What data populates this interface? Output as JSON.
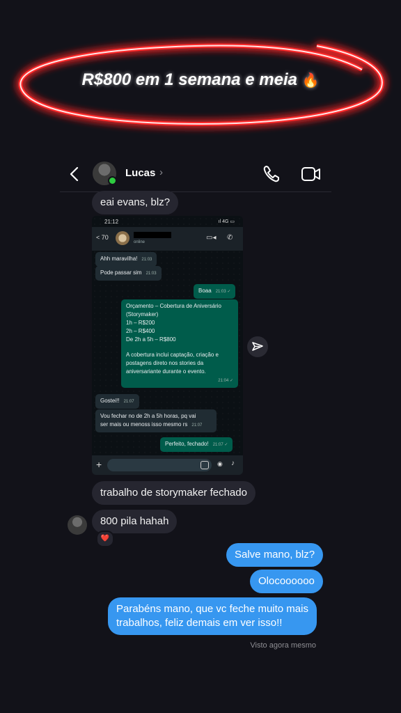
{
  "headline": {
    "text": "R$800 em 1 semana e meia",
    "emoji": "🔥"
  },
  "header": {
    "contact_name": "Lucas",
    "chevron": "›",
    "online": true
  },
  "icons": {
    "back": "chevron-left-icon",
    "call": "phone-icon",
    "video": "video-camera-icon",
    "share": "send-icon"
  },
  "messages_top": {
    "greeting": "eai evans, blz?"
  },
  "screenshot": {
    "status_time": "21:12",
    "status_icons": "ıl 4G ▭",
    "back_count": "< 70",
    "contact_status": "online",
    "messages": [
      {
        "from": "them",
        "text": "Ahh maravilha!",
        "time": "21:03"
      },
      {
        "from": "them",
        "text": "Pode passar sim",
        "time": "21:03"
      },
      {
        "from": "me",
        "text": "Boaa",
        "time": "21:03 ✓"
      },
      {
        "from": "me",
        "lines": [
          "Orçamento – Cobertura de Aniversário",
          "(Storymaker)",
          "1h – R$200",
          "2h – R$400",
          "De 2h a 5h – R$800",
          "",
          "A cobertura inclui captação, criação e",
          "postagens direto nos stories da",
          "aniversariante durante o evento."
        ],
        "time": "21:04 ✓"
      },
      {
        "from": "them",
        "text": "Gostei!!",
        "time": "21:07"
      },
      {
        "from": "them",
        "lines": [
          "Vou fechar no de 2h a 5h horas, pq vai",
          "ser mais ou menoss isso mesmo rs"
        ],
        "time": "21:07"
      },
      {
        "from": "me",
        "text": "Perfeito, fechado!",
        "time": "21:07 ✓"
      }
    ]
  },
  "messages_bottom": {
    "in_1": "trabalho de storymaker fechado",
    "in_2": "800 pila hahah",
    "reaction": "❤️",
    "out_1": "Salve mano, blz?",
    "out_2": "Olocoooooo",
    "out_3_line1": "Parabéns mano, que vc feche muito mais",
    "out_3_line2": "trabalhos, feliz demais em ver isso!!",
    "seen": "Visto agora mesmo"
  },
  "colors": {
    "background": "#121219",
    "bubble_out": "#3797f0",
    "bubble_in": "#262630",
    "neon": "#ff2a2a",
    "wa_out": "#005c4b",
    "wa_in": "#202c33"
  }
}
